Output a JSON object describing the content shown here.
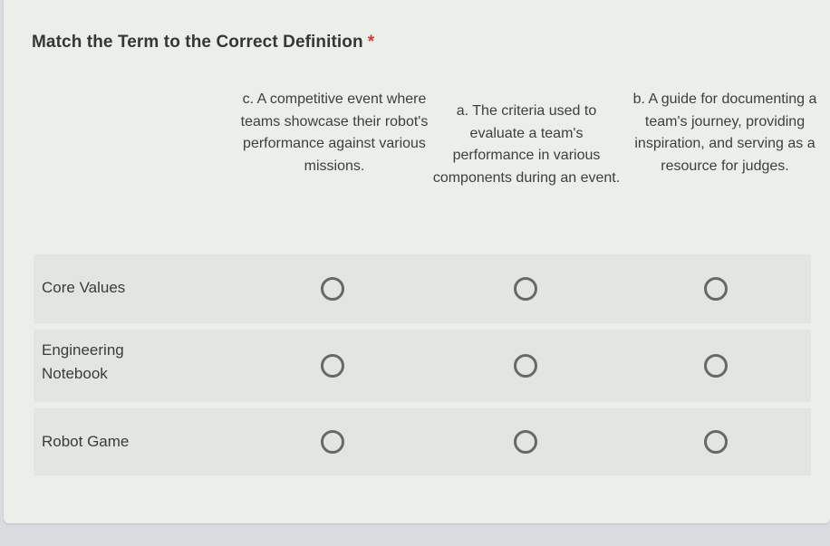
{
  "question": {
    "title": "Match the Term to the Correct Definition",
    "required_mark": "*",
    "required_color": "#c9403a"
  },
  "columns": [
    {
      "label": "c. A competitive event where teams showcase their robot's performance against various missions."
    },
    {
      "label": "a. The criteria used to evaluate a team's performance in various components during an event."
    },
    {
      "label": "b. A guide for documenting a team's journey, providing inspiration, and serving as a resource for judges."
    }
  ],
  "rows": [
    {
      "label": "Core Values",
      "selected": null
    },
    {
      "label": "Engineering Notebook",
      "selected": null
    },
    {
      "label": "Robot Game",
      "selected": null
    }
  ]
}
